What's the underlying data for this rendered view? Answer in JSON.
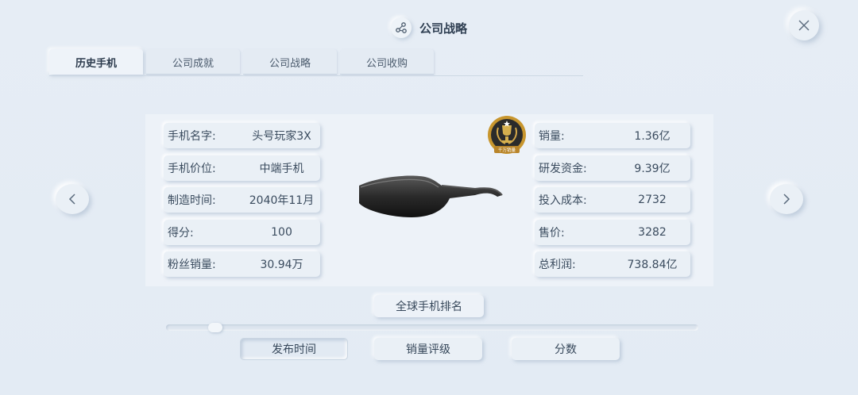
{
  "header": {
    "title": "公司战略"
  },
  "tabs": [
    {
      "label": "历史手机",
      "active": true
    },
    {
      "label": "公司成就",
      "active": false
    },
    {
      "label": "公司战略",
      "active": false
    },
    {
      "label": "公司收购",
      "active": false
    }
  ],
  "left_fields": [
    {
      "label": "手机名字:",
      "value": "头号玩家3X"
    },
    {
      "label": "手机价位:",
      "value": "中端手机"
    },
    {
      "label": "制造时间:",
      "value": "2040年11月"
    },
    {
      "label": "得分:",
      "value": "100"
    },
    {
      "label": "粉丝销量:",
      "value": "30.94万"
    }
  ],
  "right_fields": [
    {
      "label": "销量:",
      "value": "1.36亿"
    },
    {
      "label": "研发资金:",
      "value": "9.39亿"
    },
    {
      "label": "投入成本:",
      "value": "2732"
    },
    {
      "label": "售价:",
      "value": "3282"
    },
    {
      "label": "总利润:",
      "value": "738.84亿"
    }
  ],
  "badge": {
    "icon": "trophy-badge-icon",
    "text": "千万销量"
  },
  "rank_button": {
    "label": "全球手机排名"
  },
  "sort_buttons": [
    {
      "label": "发布时间",
      "active": true
    },
    {
      "label": "销量评级",
      "active": false
    },
    {
      "label": "分数",
      "active": false
    }
  ],
  "icons": {
    "header": "network-icon",
    "close": "close-icon",
    "prev": "chevron-left-icon",
    "next": "chevron-right-icon"
  },
  "colors": {
    "background": "#e5ecf4",
    "text": "#3f5063",
    "badge_gold": "#c8962e",
    "badge_dark": "#2b2b2b"
  }
}
